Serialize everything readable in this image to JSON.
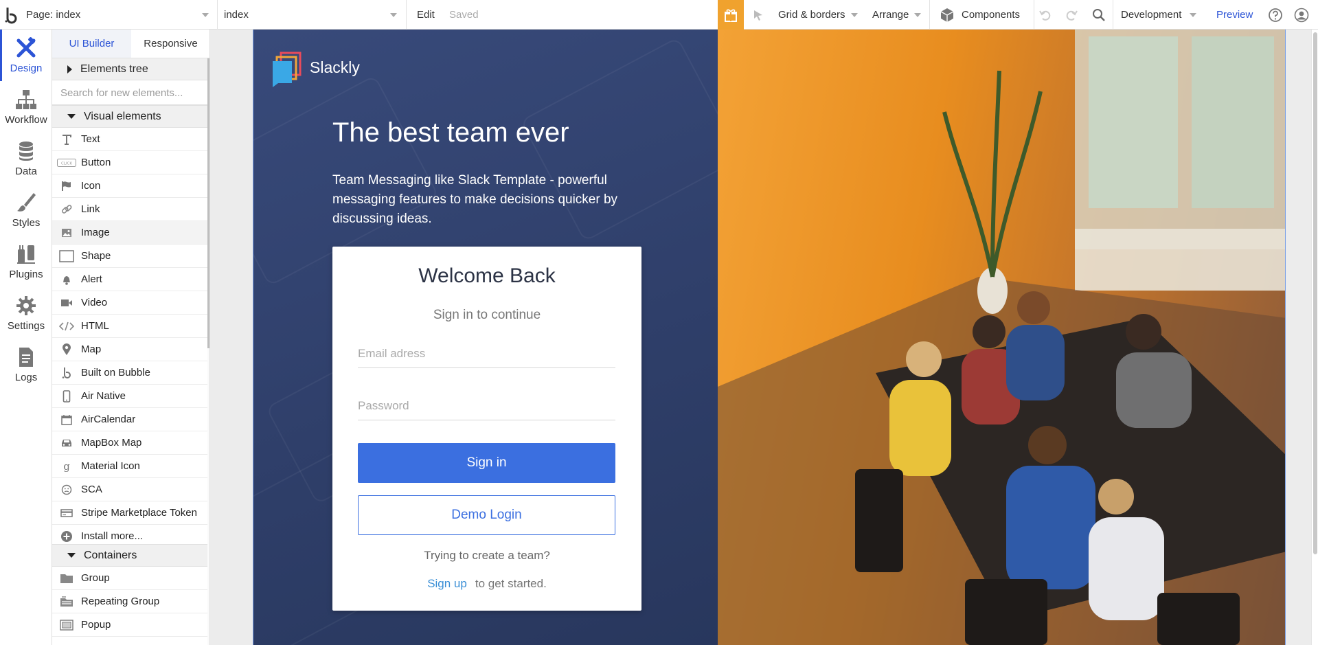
{
  "topbar": {
    "page_selector": "Page: index",
    "element_selector": "index",
    "edit_label": "Edit",
    "saved_label": "Saved",
    "grid_label": "Grid & borders",
    "arrange_label": "Arrange",
    "components_label": "Components",
    "env_label": "Development",
    "preview_label": "Preview",
    "gift_color": "#f0a22e"
  },
  "rail": {
    "items": [
      {
        "label": "Design",
        "icon": "design-icon"
      },
      {
        "label": "Workflow",
        "icon": "workflow-icon"
      },
      {
        "label": "Data",
        "icon": "database-icon"
      },
      {
        "label": "Styles",
        "icon": "brush-icon"
      },
      {
        "label": "Plugins",
        "icon": "plug-icon"
      },
      {
        "label": "Settings",
        "icon": "gear-icon"
      },
      {
        "label": "Logs",
        "icon": "document-icon"
      }
    ]
  },
  "panel": {
    "tabs": [
      "UI Builder",
      "Responsive"
    ],
    "elements_tree": "Elements tree",
    "search_placeholder": "Search for new elements...",
    "visual_section": "Visual elements",
    "visual_items": [
      {
        "label": "Text",
        "icon": "text-icon"
      },
      {
        "label": "Button",
        "icon": "button-icon"
      },
      {
        "label": "Icon",
        "icon": "flag-icon"
      },
      {
        "label": "Link",
        "icon": "link-icon"
      },
      {
        "label": "Image",
        "icon": "image-icon"
      },
      {
        "label": "Shape",
        "icon": "shape-icon"
      },
      {
        "label": "Alert",
        "icon": "bell-icon"
      },
      {
        "label": "Video",
        "icon": "video-icon"
      },
      {
        "label": "HTML",
        "icon": "code-icon"
      },
      {
        "label": "Map",
        "icon": "map-pin-icon"
      },
      {
        "label": "Built on Bubble",
        "icon": "bubble-icon"
      },
      {
        "label": "Air Native",
        "icon": "phone-icon"
      },
      {
        "label": "AirCalendar",
        "icon": "calendar-icon"
      },
      {
        "label": "MapBox Map",
        "icon": "car-icon"
      },
      {
        "label": "Material Icon",
        "icon": "material-g-icon"
      },
      {
        "label": "SCA",
        "icon": "smiley-icon"
      },
      {
        "label": "Stripe Marketplace Token",
        "icon": "card-icon"
      },
      {
        "label": "Install more...",
        "icon": "plus-circle-icon"
      }
    ],
    "containers_section": "Containers",
    "container_items": [
      {
        "label": "Group",
        "icon": "folder-icon"
      },
      {
        "label": "Repeating Group",
        "icon": "repeating-group-icon"
      },
      {
        "label": "Popup",
        "icon": "popup-icon"
      }
    ]
  },
  "page": {
    "brand": "Slackly",
    "headline": "The best team ever",
    "subhead": "Team Messaging like Slack Template - powerful messaging features to make decisions quicker by discussing ideas.",
    "card": {
      "title": "Welcome Back",
      "subtitle": "Sign in to continue",
      "email_placeholder": "Email adress",
      "password_placeholder": "Password",
      "signin_label": "Sign in",
      "demo_label": "Demo Login",
      "footer_question": "Trying to create a team?",
      "signup_link": "Sign up",
      "signup_tail": "to get started."
    },
    "colors": {
      "primary_button": "#3b6fe0",
      "left_panel": "#2f3f6a",
      "photo_accent": "#f0a22e",
      "link": "#3b8fd6"
    }
  }
}
